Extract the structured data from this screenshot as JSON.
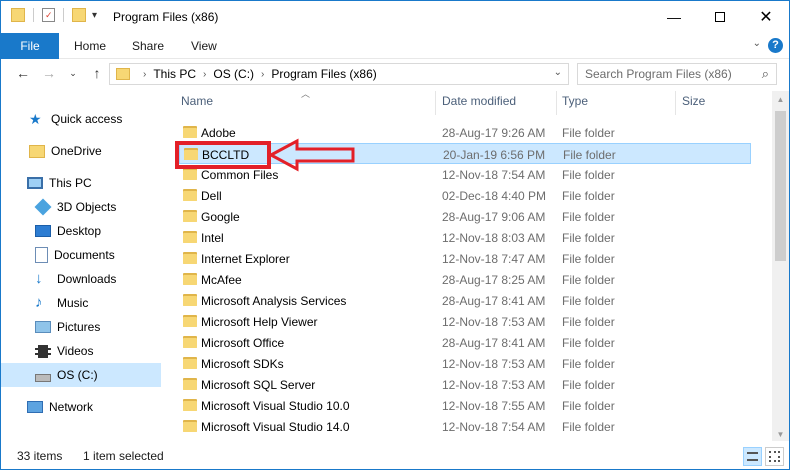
{
  "window": {
    "title": "Program Files (x86)",
    "minimize_icon": "minimize-icon",
    "maximize_icon": "maximize-icon",
    "close_icon": "close-icon"
  },
  "ribbon": {
    "tabs": [
      "File",
      "Home",
      "Share",
      "View"
    ],
    "help": "?"
  },
  "address": {
    "crumbs": [
      "This PC",
      "OS (C:)",
      "Program Files (x86)"
    ],
    "search_placeholder": "Search Program Files (x86)"
  },
  "navpane": {
    "items": [
      {
        "label": "Quick access",
        "icon": "star-icon"
      },
      {
        "label": "OneDrive",
        "icon": "folder-icon"
      },
      {
        "label": "This PC",
        "icon": "computer-icon"
      },
      {
        "label": "3D Objects",
        "icon": "cube-icon"
      },
      {
        "label": "Desktop",
        "icon": "desktop-icon"
      },
      {
        "label": "Documents",
        "icon": "document-icon"
      },
      {
        "label": "Downloads",
        "icon": "download-icon"
      },
      {
        "label": "Music",
        "icon": "music-icon"
      },
      {
        "label": "Pictures",
        "icon": "picture-icon"
      },
      {
        "label": "Videos",
        "icon": "video-icon"
      },
      {
        "label": "OS (C:)",
        "icon": "drive-icon"
      },
      {
        "label": "Network",
        "icon": "network-icon"
      }
    ]
  },
  "columns": [
    "Name",
    "Date modified",
    "Type",
    "Size"
  ],
  "files": [
    {
      "name": "Adobe",
      "date": "28-Aug-17 9:26 AM",
      "type": "File folder"
    },
    {
      "name": "BCCLTD",
      "date": "20-Jan-19 6:56 PM",
      "type": "File folder"
    },
    {
      "name": "Common Files",
      "date": "12-Nov-18 7:54 AM",
      "type": "File folder"
    },
    {
      "name": "Dell",
      "date": "02-Dec-18 4:40 PM",
      "type": "File folder"
    },
    {
      "name": "Google",
      "date": "28-Aug-17 9:06 AM",
      "type": "File folder"
    },
    {
      "name": "Intel",
      "date": "12-Nov-18 8:03 AM",
      "type": "File folder"
    },
    {
      "name": "Internet Explorer",
      "date": "12-Nov-18 7:47 AM",
      "type": "File folder"
    },
    {
      "name": "McAfee",
      "date": "28-Aug-17 8:25 AM",
      "type": "File folder"
    },
    {
      "name": "Microsoft Analysis Services",
      "date": "28-Aug-17 8:41 AM",
      "type": "File folder"
    },
    {
      "name": "Microsoft Help Viewer",
      "date": "12-Nov-18 7:53 AM",
      "type": "File folder"
    },
    {
      "name": "Microsoft Office",
      "date": "28-Aug-17 8:41 AM",
      "type": "File folder"
    },
    {
      "name": "Microsoft SDKs",
      "date": "12-Nov-18 7:53 AM",
      "type": "File folder"
    },
    {
      "name": "Microsoft SQL Server",
      "date": "12-Nov-18 7:53 AM",
      "type": "File folder"
    },
    {
      "name": "Microsoft Visual Studio 10.0",
      "date": "12-Nov-18 7:55 AM",
      "type": "File folder"
    },
    {
      "name": "Microsoft Visual Studio 14.0",
      "date": "12-Nov-18 7:54 AM",
      "type": "File folder"
    }
  ],
  "selected_file": "BCCLTD",
  "status": {
    "count": "33 items",
    "selection": "1 item selected"
  },
  "colors": {
    "accent": "#1979ca",
    "selection": "#cce8ff",
    "annotation": "#e32028",
    "folder": "#f7d774"
  }
}
